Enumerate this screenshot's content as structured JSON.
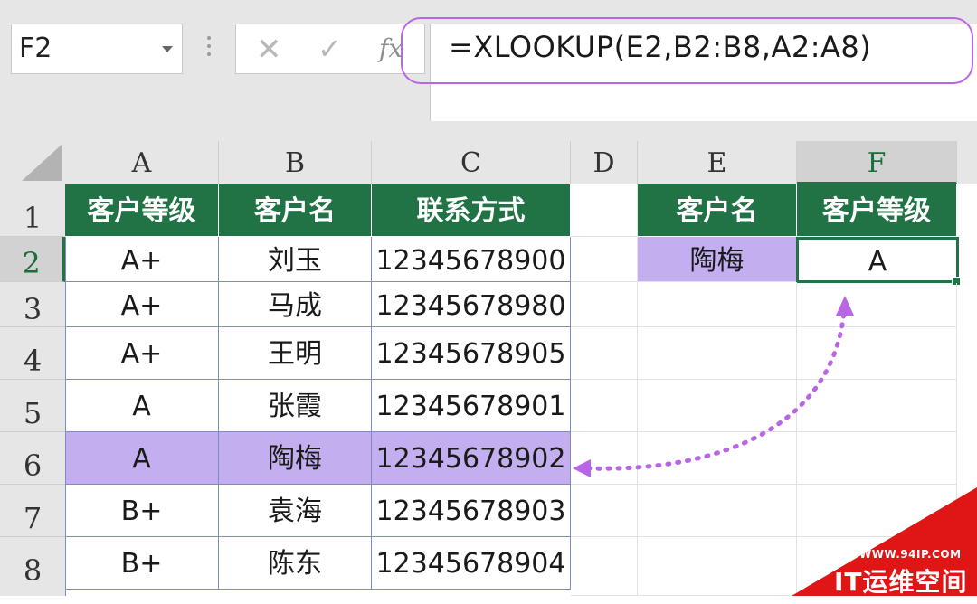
{
  "formula_bar": {
    "name_box": "F2",
    "cancel_icon": "✕",
    "enter_icon": "✓",
    "function_icon": "fx",
    "formula": "=XLOOKUP(E2,B2:B8,A2:A8)"
  },
  "columns": [
    "A",
    "B",
    "C",
    "D",
    "E",
    "F"
  ],
  "rows": [
    "1",
    "2",
    "3",
    "4",
    "5",
    "6",
    "7",
    "8"
  ],
  "table": {
    "headers": [
      "客户等级",
      "客户名",
      "联系方式"
    ],
    "rows": [
      {
        "level": "A+",
        "name": "刘玉",
        "contact": "12345678900"
      },
      {
        "level": "A+",
        "name": "马成",
        "contact": "12345678980"
      },
      {
        "level": "A+",
        "name": "王明",
        "contact": "12345678905"
      },
      {
        "level": "A",
        "name": "张霞",
        "contact": "12345678901"
      },
      {
        "level": "A",
        "name": "陶梅",
        "contact": "12345678902"
      },
      {
        "level": "B+",
        "name": "袁海",
        "contact": "12345678903"
      },
      {
        "level": "B+",
        "name": "陈东",
        "contact": "12345678904"
      }
    ]
  },
  "lookup": {
    "header_name": "客户名",
    "header_level": "客户等级",
    "input_name": "陶梅",
    "result_level": "A"
  },
  "colors": {
    "header_green": "#217346",
    "highlight_purple": "#c3aef0",
    "arrow_purple": "#b865e6",
    "watermark_red": "#e01515"
  },
  "watermark": {
    "url": "WWW.94IP.COM",
    "brand": "IT运维空间"
  }
}
